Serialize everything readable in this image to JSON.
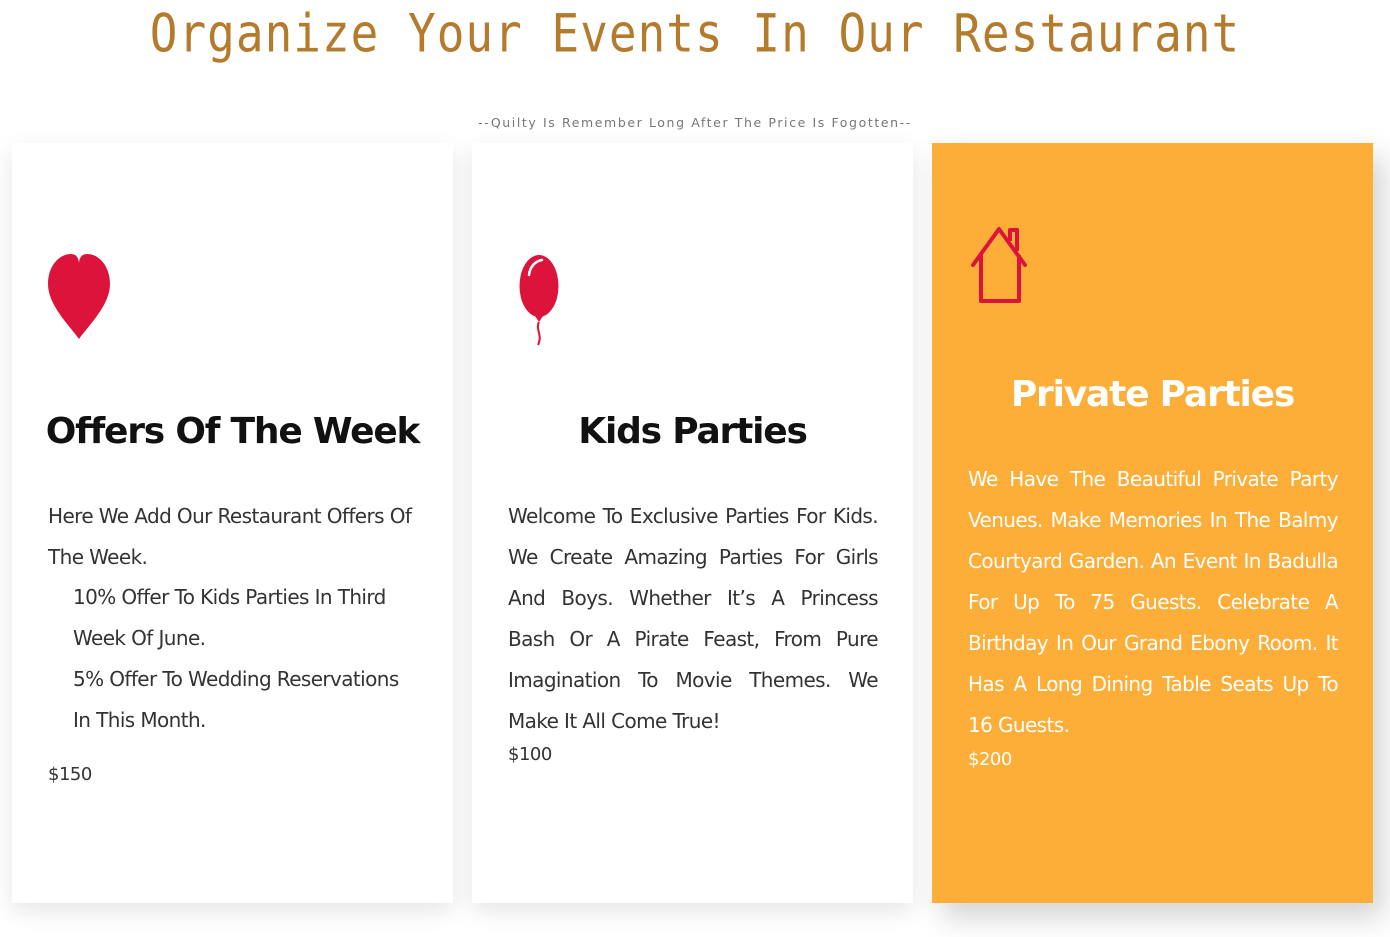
{
  "header": {
    "title": "Organize Your Events In Our Restaurant",
    "subtitle": "--Quilty Is Remember Long After The Price Is Fogotten--"
  },
  "colors": {
    "title": "#b47b2c",
    "icon_red": "#dc143c",
    "highlight_card": "#fdae38"
  },
  "cards": [
    {
      "icon": "heart-icon",
      "title": "Offers Of The Week",
      "text": "Here We Add Our Restaurant Offers Of The Week.",
      "offers": [
        "10% Offer To Kids Parties In Third Week Of June.",
        "5% Offer To Wedding Reservations In This Month."
      ],
      "price": "$150"
    },
    {
      "icon": "balloon-icon",
      "title": "Kids Parties",
      "text": "Welcome To Exclusive Parties For Kids. We Create Amazing Parties For Girls And Boys. Whether It’s A Princess Bash Or A Pirate Feast, From Pure Imagination To Movie Themes. We Make It All Come True!",
      "price": "$100"
    },
    {
      "icon": "house-icon",
      "title": "Private Parties",
      "text": "We Have The Beautiful Private Party Venues. Make Memories In The Balmy Courtyard Garden. An Event In Badulla For Up To 75 Guests. Celebrate A Birthday In Our Grand Ebony Room. It Has A Long Dining Table Seats Up To 16 Guests.",
      "price": "$200"
    }
  ]
}
